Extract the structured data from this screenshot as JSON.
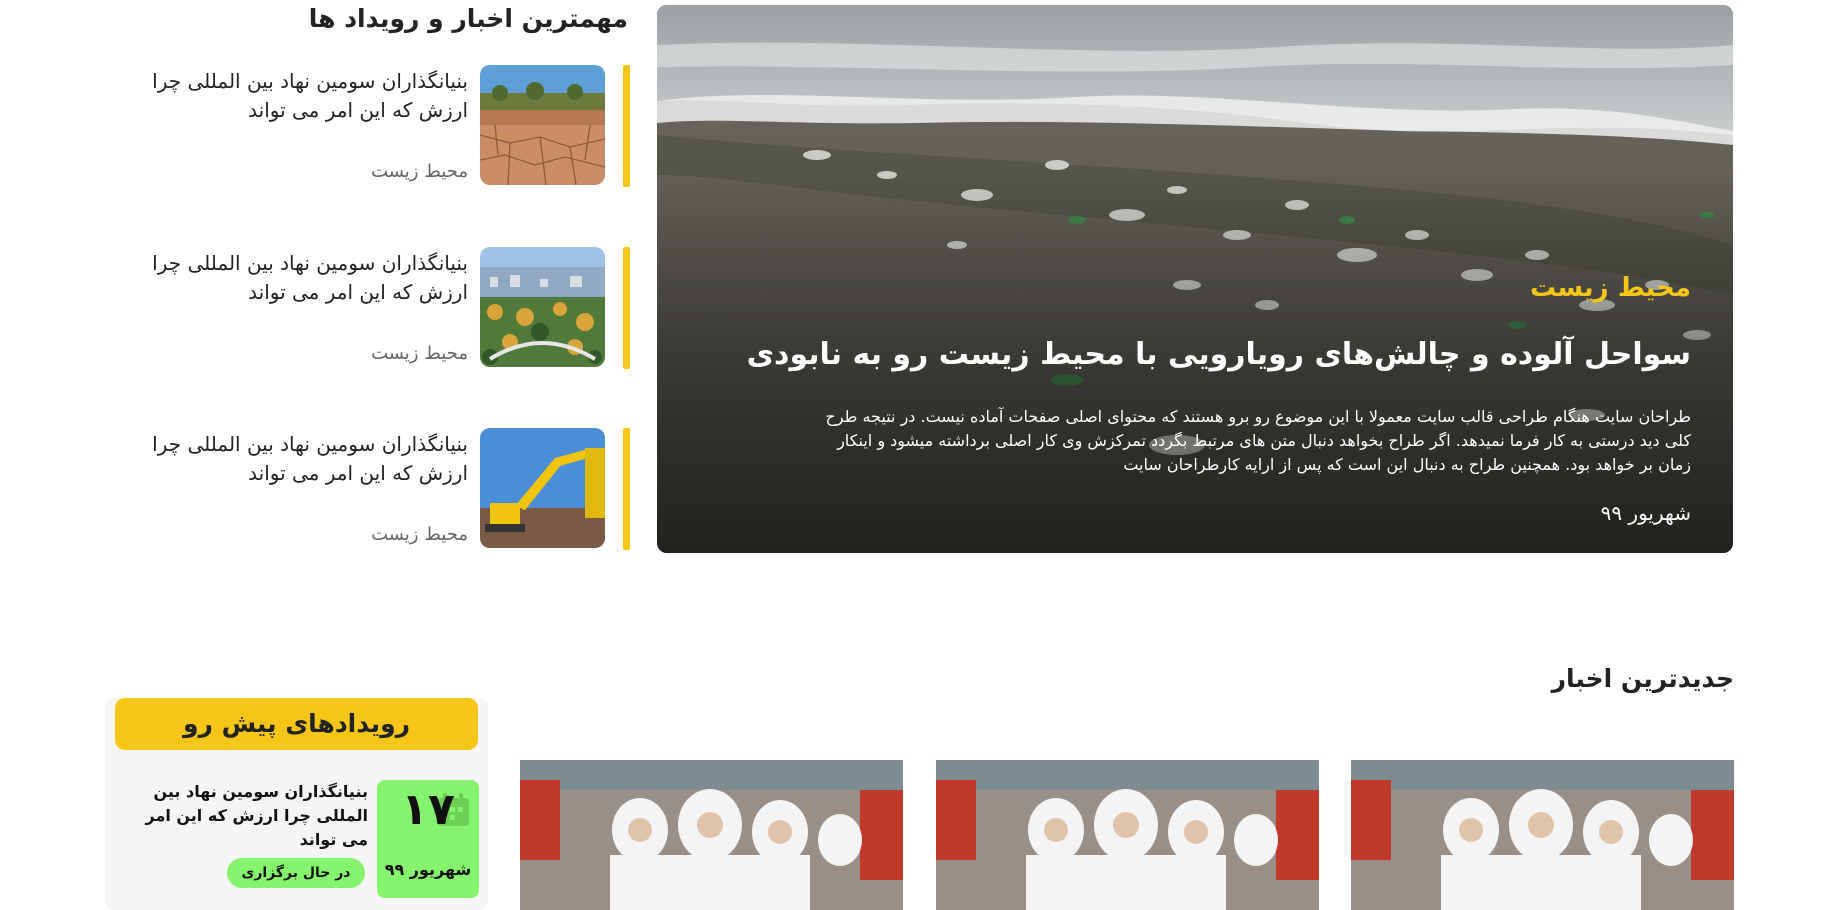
{
  "top_news": {
    "title": "مهمترین اخبار و رویداد ها",
    "items": [
      {
        "title": "بنیانگذاران سومین نهاد بین المللی چرا ارزش که این امر می تواند",
        "category": "محیط زیست",
        "image": "drought-cracked-earth"
      },
      {
        "title": "بنیانگذاران سومین نهاد بین المللی چرا ارزش که این امر می تواند",
        "category": "محیط زیست",
        "image": "city-forest-aerial"
      },
      {
        "title": "بنیانگذاران سومین نهاد بین المللی چرا ارزش که این امر می تواند",
        "category": "محیط زیست",
        "image": "excavator"
      }
    ]
  },
  "hero": {
    "category": "محیط زیست",
    "title": "سواحل آلوده و چالش‌های رویارویی با محیط زیست رو به نابودی",
    "excerpt": "طراحان سایت هنگام طراحی قالب سایت معمولا با این موضوع رو برو هستند که محتوای اصلی صفحات آماده نیست. در نتیجه طرح کلی دید درستی به کار فرما نمیدهد. اگر طراح بخواهد دنبال متن های مرتبط بگردد تمرکزش وی کار اصلی برداشته میشود و اینکار زمان بر خواهد بود. همچنین طراح به دنبال این است که پس از ارایه کارطراحان سایت",
    "date": "شهریور ۹۹",
    "image": "polluted-beach"
  },
  "latest": {
    "title": "جدیدترین اخبار",
    "cards": [
      {
        "image": "workers-in-protective-suits"
      },
      {
        "image": "workers-in-protective-suits"
      },
      {
        "image": "workers-in-protective-suits"
      }
    ]
  },
  "events": {
    "title": "رویدادهای پیش رو",
    "items": [
      {
        "day": "۱۷",
        "month": "شهریور ۹۹",
        "title": "بنیانگذاران سومین نهاد بین المللی چرا ارزش که این امر می تواند",
        "status": "در حال برگزاری",
        "icon": "calendar-icon"
      }
    ]
  },
  "colors": {
    "accent": "#f5c518",
    "event_green": "#86f36e",
    "panel_bg": "#f5f5f5"
  }
}
